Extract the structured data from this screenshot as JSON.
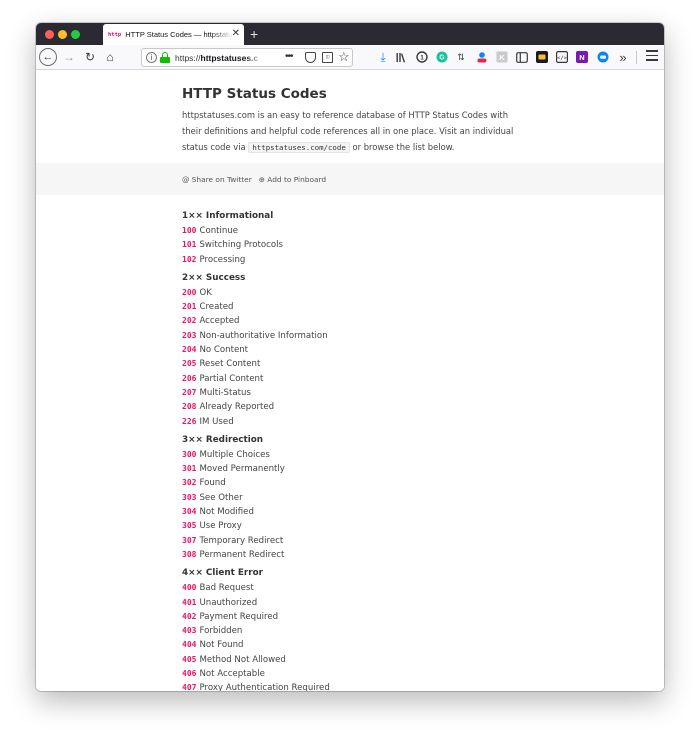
{
  "browser": {
    "tab": {
      "favicon_text": "http",
      "title": "HTTP Status Codes — httpstatuses.com",
      "close_icon": "close-icon"
    },
    "new_tab_icon": "plus-icon",
    "address": {
      "prefix": "https://",
      "host": "httpstatuses.c"
    },
    "icons": [
      "back-icon",
      "forward-icon",
      "reload-icon",
      "home-icon",
      "info-icon",
      "lock-icon",
      "more-icon",
      "pocket-icon",
      "reader-icon",
      "star-icon",
      "download-icon",
      "library-icon",
      "extension-icons",
      "overflow-icon",
      "menu-icon"
    ]
  },
  "page": {
    "title": "HTTP Status Codes",
    "description_before": "httpstatuses.com is an easy to reference database of HTTP Status Codes with their definitions and helpful code references all in one place. Visit an individual status code via ",
    "description_code": "httpstatuses.com/code",
    "description_after": " or browse the list below.",
    "share_twitter": "@ Share on Twitter",
    "add_pinboard": "⊕ Add to Pinboard"
  },
  "groups": [
    {
      "heading": "1×× Informational",
      "items": [
        {
          "code": "100",
          "label": "Continue"
        },
        {
          "code": "101",
          "label": "Switching Protocols"
        },
        {
          "code": "102",
          "label": "Processing"
        }
      ]
    },
    {
      "heading": "2×× Success",
      "items": [
        {
          "code": "200",
          "label": "OK"
        },
        {
          "code": "201",
          "label": "Created"
        },
        {
          "code": "202",
          "label": "Accepted"
        },
        {
          "code": "203",
          "label": "Non-authoritative Information"
        },
        {
          "code": "204",
          "label": "No Content"
        },
        {
          "code": "205",
          "label": "Reset Content"
        },
        {
          "code": "206",
          "label": "Partial Content"
        },
        {
          "code": "207",
          "label": "Multi-Status"
        },
        {
          "code": "208",
          "label": "Already Reported"
        },
        {
          "code": "226",
          "label": "IM Used"
        }
      ]
    },
    {
      "heading": "3×× Redirection",
      "items": [
        {
          "code": "300",
          "label": "Multiple Choices"
        },
        {
          "code": "301",
          "label": "Moved Permanently"
        },
        {
          "code": "302",
          "label": "Found"
        },
        {
          "code": "303",
          "label": "See Other"
        },
        {
          "code": "304",
          "label": "Not Modified"
        },
        {
          "code": "305",
          "label": "Use Proxy"
        },
        {
          "code": "307",
          "label": "Temporary Redirect"
        },
        {
          "code": "308",
          "label": "Permanent Redirect"
        }
      ]
    },
    {
      "heading": "4×× Client Error",
      "items": [
        {
          "code": "400",
          "label": "Bad Request"
        },
        {
          "code": "401",
          "label": "Unauthorized"
        },
        {
          "code": "402",
          "label": "Payment Required"
        },
        {
          "code": "403",
          "label": "Forbidden"
        },
        {
          "code": "404",
          "label": "Not Found"
        },
        {
          "code": "405",
          "label": "Method Not Allowed"
        },
        {
          "code": "406",
          "label": "Not Acceptable"
        },
        {
          "code": "407",
          "label": "Proxy Authentication Required"
        }
      ]
    }
  ],
  "colors": {
    "code": "#e8146a",
    "tab_bar": "#2b2a33",
    "lock": "#12bc00"
  }
}
